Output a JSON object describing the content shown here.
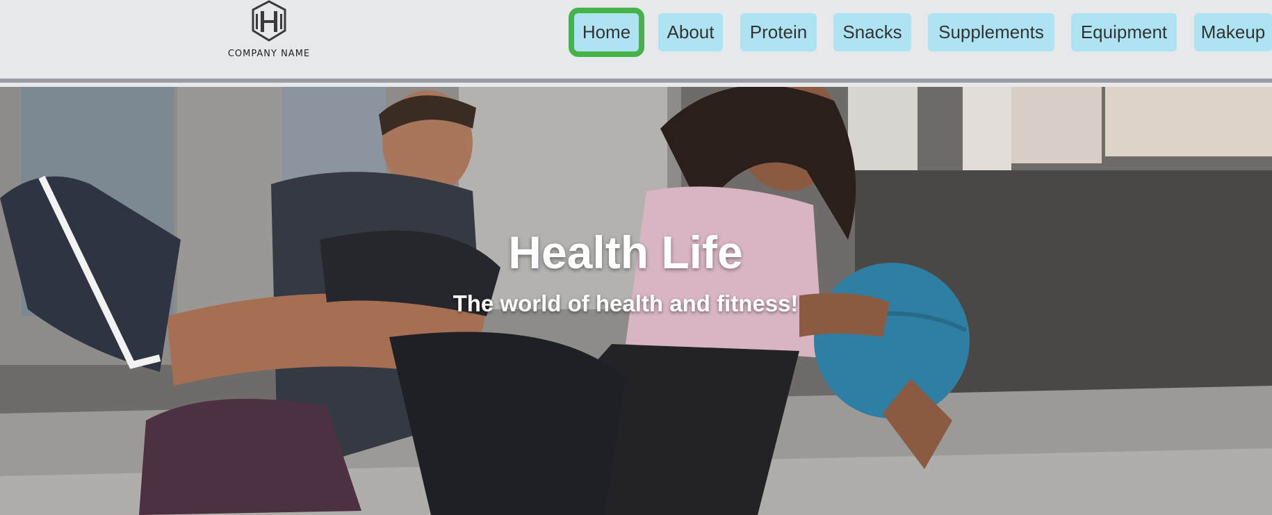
{
  "header": {
    "logo_text": "COMPANY NAME",
    "logo_icon": "h-shield-icon"
  },
  "nav": {
    "items": [
      {
        "label": "Home",
        "active": true
      },
      {
        "label": "About"
      },
      {
        "label": "Protein"
      },
      {
        "label": "Snacks"
      },
      {
        "label": "Supplements"
      },
      {
        "label": "Equipment"
      },
      {
        "label": "Makeup"
      }
    ],
    "active_outline_color": "#45b34a",
    "item_color": "#aee3f2"
  },
  "hero": {
    "title": "Health Life",
    "subtitle": "The world of health and fitness!",
    "image": "fitness-couple-workout-photo"
  }
}
